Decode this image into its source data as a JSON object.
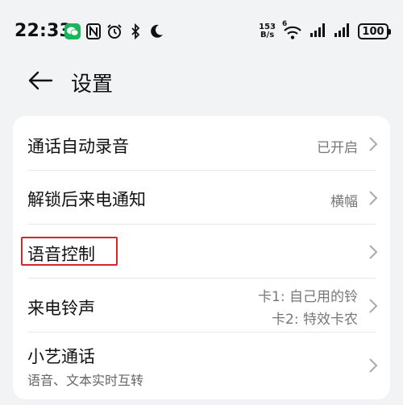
{
  "status_bar": {
    "time": "22:33",
    "net_speed_value": "153",
    "net_speed_unit": "B/s",
    "wifi_label": "6",
    "battery": "100"
  },
  "header": {
    "title": "设置"
  },
  "settings": [
    {
      "title": "通话自动录音",
      "value": "已开启"
    },
    {
      "title": "解锁后来电通知",
      "value": "横幅"
    },
    {
      "title": "语音控制"
    },
    {
      "title": "来电铃声",
      "value_line1": "卡1: 自己用的铃",
      "value_line2": "卡2: 特效卡农"
    },
    {
      "title": "小艺通话",
      "subtitle": "语音、文本实时互转"
    }
  ],
  "colors": {
    "background": "#f1f3f5",
    "card": "#ffffff",
    "highlight": "#d6262c"
  }
}
